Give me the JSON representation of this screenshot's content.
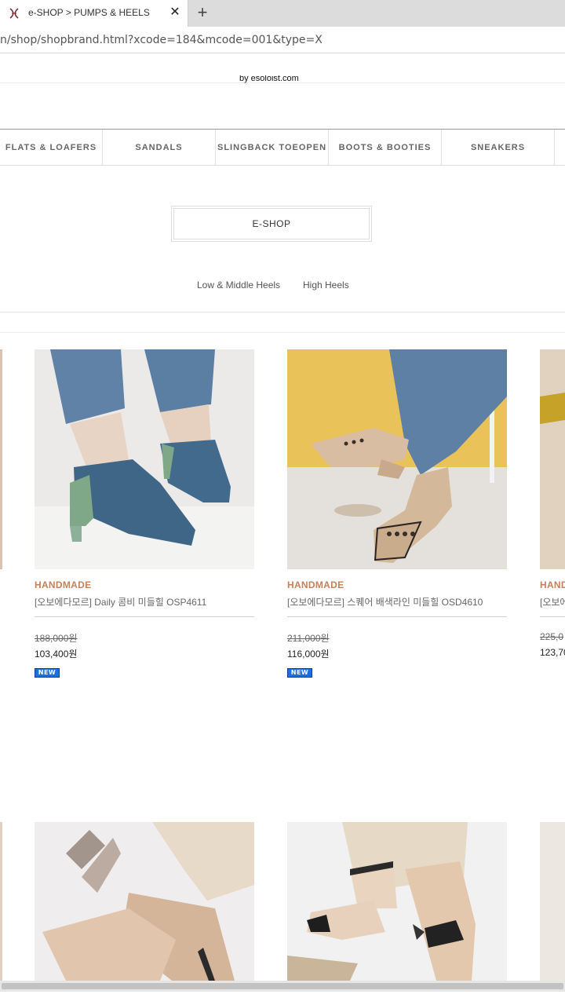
{
  "browser": {
    "tab_title": "e-SHOP > PUMPS & HEELS",
    "close_glyph": "✕",
    "new_tab_glyph": "+",
    "url": "n/shop/shopbrand.html?xcode=184&mcode=001&type=X"
  },
  "header": {
    "logo_text": "by esoloist.com"
  },
  "categories": [
    {
      "label": "FLATS & LOAFERS"
    },
    {
      "label": "SANDALS"
    },
    {
      "label": "SLINGBACK TOEOPEN"
    },
    {
      "label": "BOOTS & BOOTIES"
    },
    {
      "label": "SNEAKERS"
    }
  ],
  "section": {
    "title": "E-SHOP",
    "subnav": [
      "Low & Middle Heels",
      "High Heels"
    ]
  },
  "products": [
    {
      "brand": "HANDMADE",
      "name": "[오보에다모르] Daily 콤비 미들힐 OSP4611",
      "price_old": "188,000원",
      "price_new": "103,400원",
      "badge": "NEW"
    },
    {
      "brand": "HANDMADE",
      "name": "[오보에다모르] 스퀘어 배색라인 미들힐 OSD4610",
      "price_old": "211,000원",
      "price_new": "116,000원",
      "badge": "NEW"
    },
    {
      "brand": "HAND",
      "name": "[오보에",
      "price_old": "225,0",
      "price_new": "123,70"
    }
  ],
  "colors": {
    "brand_accent": "#c8805a",
    "badge_blue": "#1d6fe0"
  }
}
